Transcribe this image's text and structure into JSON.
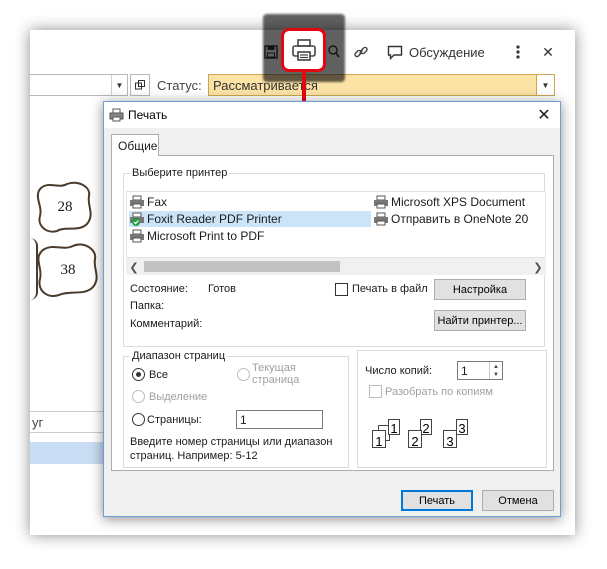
{
  "bg_window": {
    "discuss_label": "Обсуждение",
    "status_label": "Статус:",
    "status_value": "Рассматривается",
    "bubbles": [
      "28",
      "38"
    ],
    "table_header_fragment": "уг",
    "highlight_color": "#e30613",
    "status_color": "#fbe3a6"
  },
  "dialog": {
    "title": "Печать",
    "close_glyph": "✕",
    "tab_label": "Общие",
    "printer_group_label": "Выберите принтер",
    "printers_left": [
      "Fax",
      "Foxit Reader PDF Printer",
      "Microsoft Print to PDF"
    ],
    "printers_right": [
      "Microsoft XPS Document",
      "Отправить в OneNote 20"
    ],
    "selected_printer": "Foxit Reader PDF Printer",
    "state_label": "Состояние:",
    "state_value": "Готов",
    "folder_label": "Папка:",
    "comment_label": "Комментарий:",
    "print_to_file_label": "Печать в файл",
    "setup_button": "Настройка",
    "find_printer_button": "Найти принтер...",
    "range_label": "Диапазон страниц",
    "range_all": "Все",
    "range_current": "Текущая страница",
    "range_selection": "Выделение",
    "range_pages": "Страницы:",
    "pages_value": "1",
    "range_hint": "Введите номер страницы или диапазон страниц.  Например: 5-12",
    "copies_label": "Число копий:",
    "copies_value": "1",
    "collate_label": "Разобрать по копиям",
    "print_button": "Печать",
    "cancel_button": "Отмена"
  }
}
